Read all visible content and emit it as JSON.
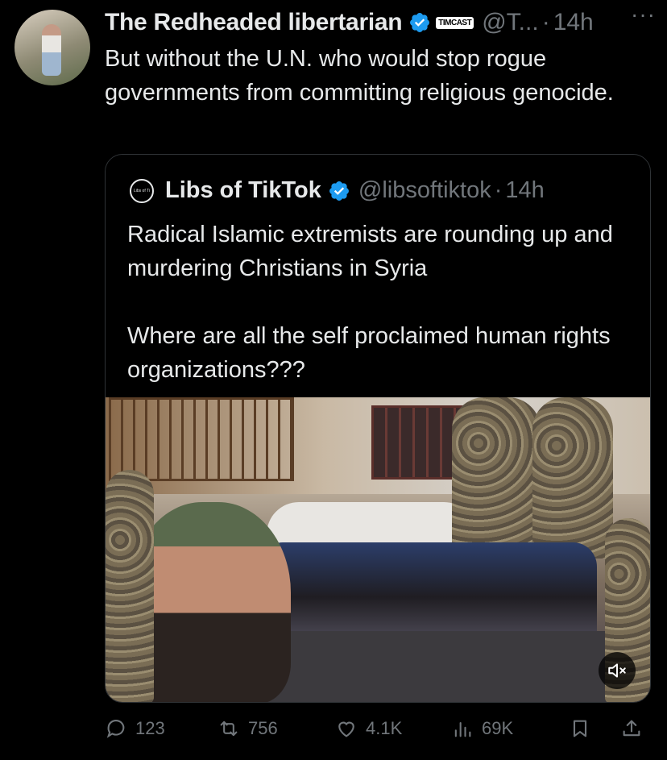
{
  "tweet": {
    "author_name": "The Redheaded libertarian",
    "badge_label": "TIMCAST",
    "handle": "@T...",
    "separator": "·",
    "time": "14h",
    "more_label": "···",
    "text": "But without the U.N. who would stop rogue governments from committing religious genocide."
  },
  "quoted": {
    "logo_text": "Libs of TikTok",
    "author_name": "Libs of TikTok",
    "handle": "@libsoftiktok",
    "separator": "·",
    "time": "14h",
    "text": "Radical Islamic extremists are rounding up and murdering Christians in Syria\n\nWhere are all the self proclaimed human rights organizations???"
  },
  "actions": {
    "replies": "123",
    "reposts": "756",
    "likes": "4.1K",
    "views": "69K"
  },
  "colors": {
    "verified": "#1d9bf0",
    "muted_text": "#71767b",
    "border": "#2f3336"
  },
  "icons": [
    "reply-icon",
    "repost-icon",
    "like-icon",
    "views-icon",
    "bookmark-icon",
    "share-icon",
    "mute-icon",
    "verified-icon",
    "more-icon"
  ]
}
